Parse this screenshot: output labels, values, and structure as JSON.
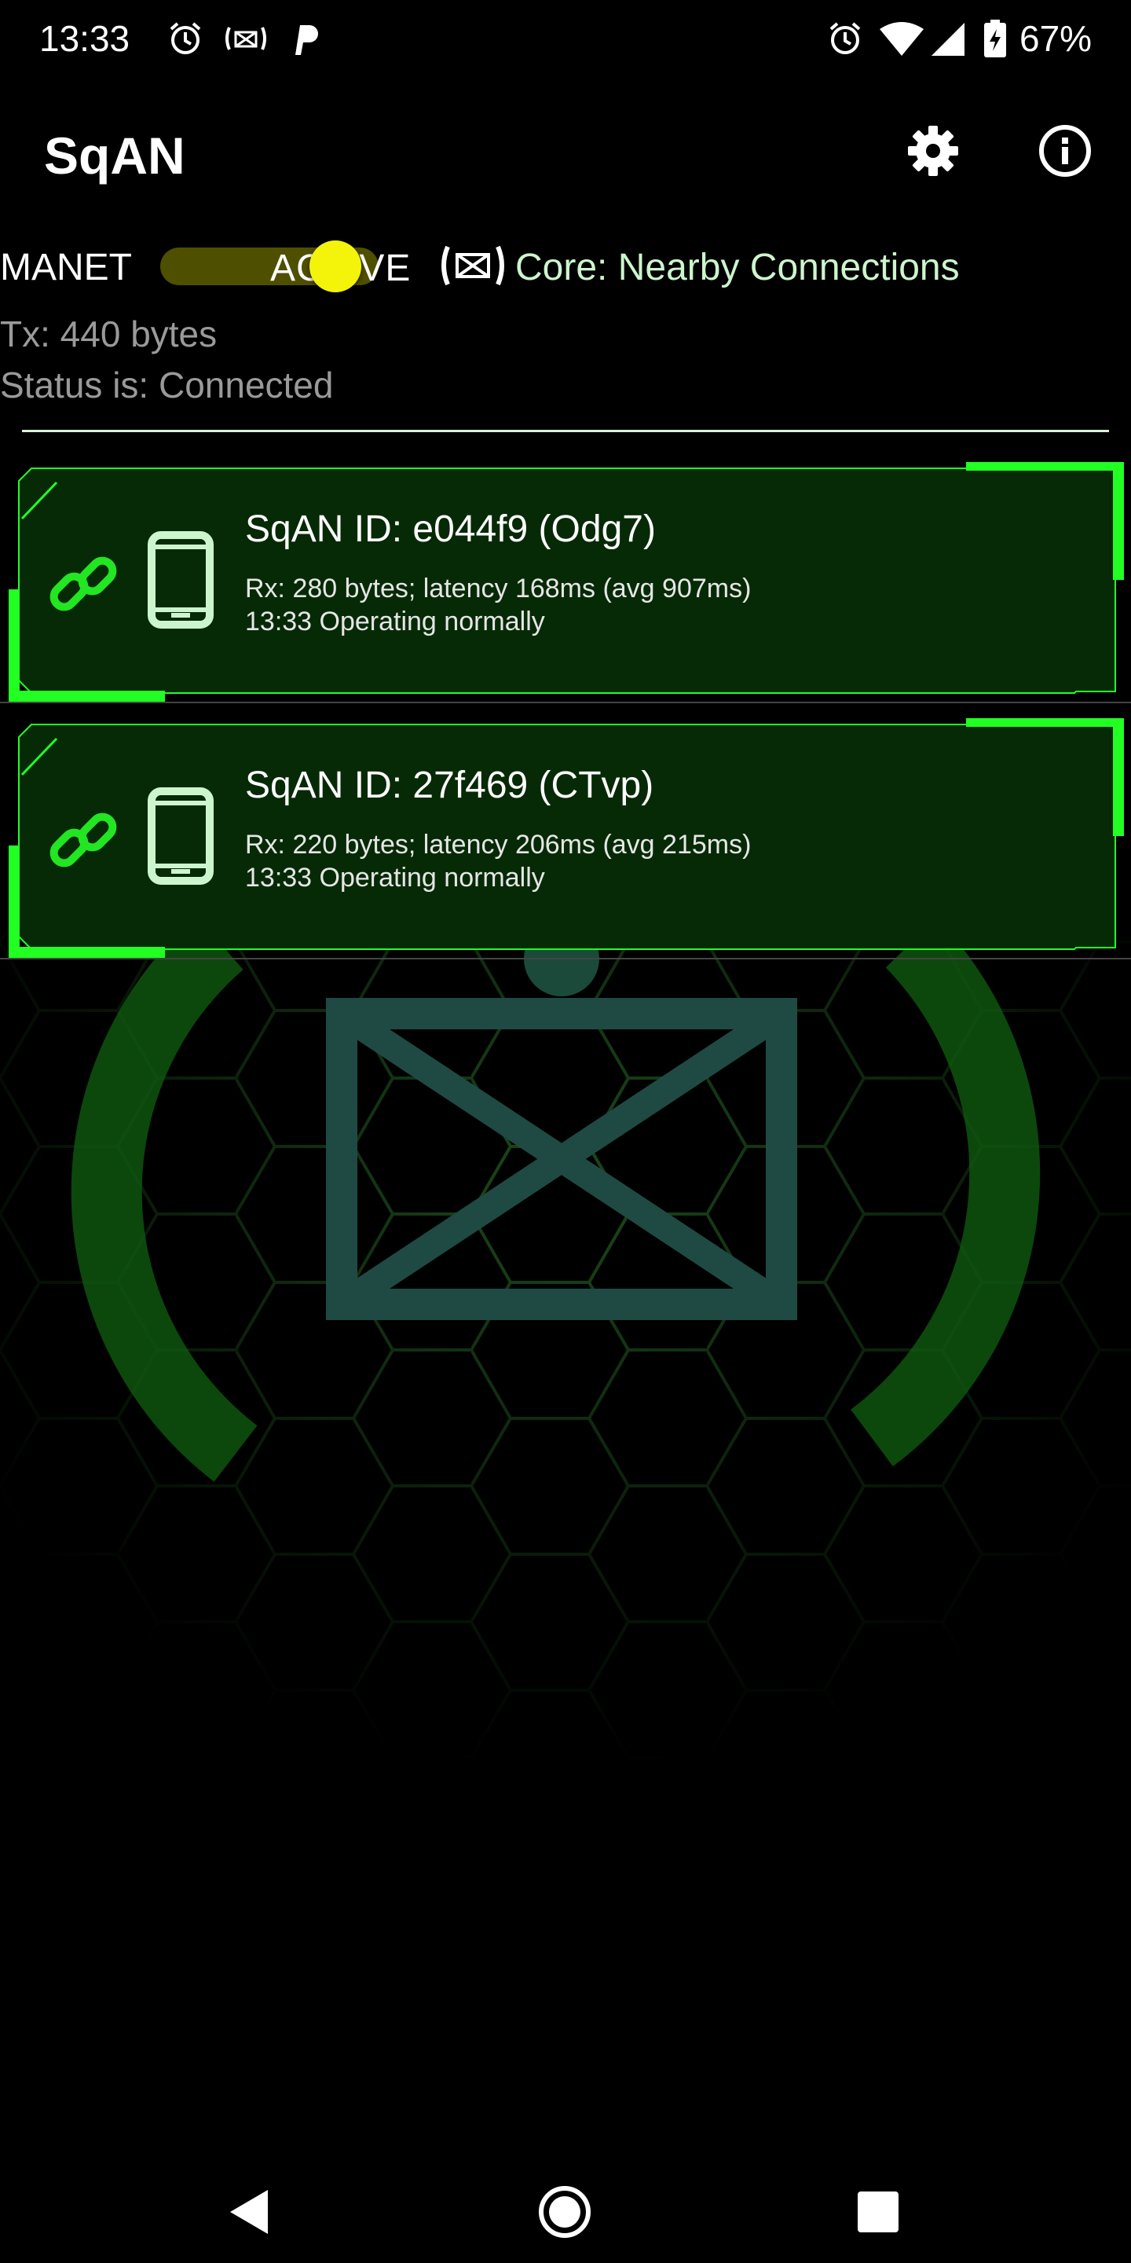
{
  "status_bar": {
    "time": "13:33",
    "battery": "67%",
    "icons": [
      "alarm-icon",
      "nearby-connections-icon",
      "p-icon",
      "alarm-icon",
      "wifi-icon",
      "cell-signal-icon",
      "battery-charging-icon"
    ]
  },
  "app_bar": {
    "title": "SqAN",
    "actions": [
      "gear-icon",
      "info-icon"
    ]
  },
  "controls": {
    "manet_label": "MANET",
    "toggle_label": "ACTIVE",
    "toggle_on": true,
    "core_label": "Core: Nearby Connections"
  },
  "stats": {
    "tx": "Tx: 440 bytes",
    "status": "Status is: Connected"
  },
  "peers": [
    {
      "title": "SqAN ID: e044f9 (Odg7)",
      "rx": "Rx: 280 bytes; latency 168ms (avg 907ms)",
      "status": "13:33 Operating normally"
    },
    {
      "title": "SqAN ID: 27f469 (CTvp)",
      "rx": "Rx: 220 bytes; latency 206ms (avg 215ms)",
      "status": "13:33 Operating normally"
    }
  ],
  "colors": {
    "accent_green": "#22ff22",
    "card_fill": "#062a06",
    "toggle_thumb": "#f4f40a",
    "toggle_track": "#4f4f00",
    "core_text": "#cdf5cd"
  },
  "nav_bar": [
    "back-icon",
    "home-icon",
    "recents-icon"
  ]
}
